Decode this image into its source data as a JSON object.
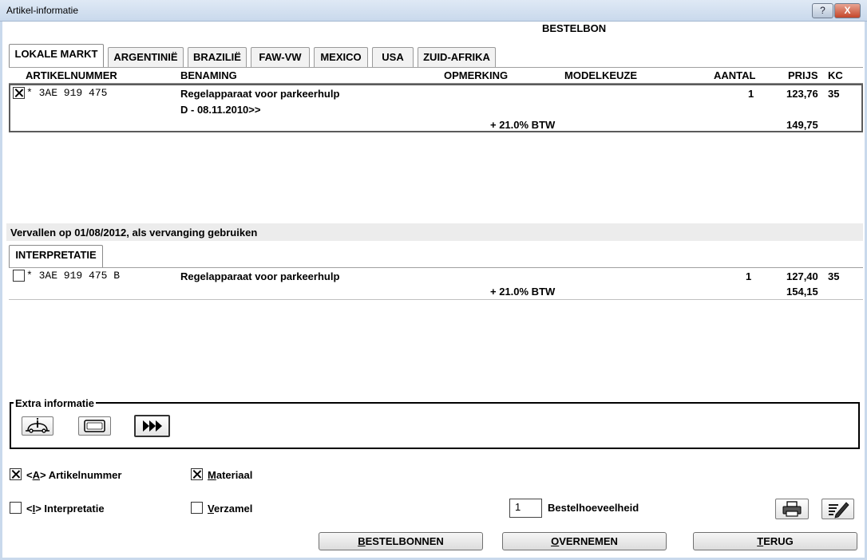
{
  "window": {
    "title": "Artikel-informatie",
    "help_label": "?",
    "close_label": "X"
  },
  "header": {
    "order_title": "BESTELBON"
  },
  "tabs": [
    {
      "label": "LOKALE MARKT",
      "active": true
    },
    {
      "label": "ARGENTINIË",
      "active": false
    },
    {
      "label": "BRAZILIË",
      "active": false
    },
    {
      "label": "FAW-VW",
      "active": false
    },
    {
      "label": "MEXICO",
      "active": false
    },
    {
      "label": "USA",
      "active": false
    },
    {
      "label": "ZUID-AFRIKA",
      "active": false
    }
  ],
  "columns": {
    "article_number": "ARTIKELNUMMER",
    "name": "BENAMING",
    "remark": "OPMERKING",
    "model_choice": "MODELKEUZE",
    "quantity": "AANTAL",
    "price": "PRIJS",
    "kc": "KC"
  },
  "main_item": {
    "checked": true,
    "article_number": "* 3AE 919 475",
    "name": "Regelapparaat voor parkeerhulp",
    "name_line2": "D - 08.11.2010>>",
    "quantity": "1",
    "price": "123,76",
    "kc": "35",
    "vat_label": "+ 21.0% BTW",
    "price_incl_vat": "149,75"
  },
  "replacement": {
    "notice": "Vervallen op 01/08/2012, als vervanging gebruiken",
    "tab_label": "INTERPRETATIE",
    "item": {
      "checked": false,
      "article_number": "* 3AE 919 475 B",
      "name": "Regelapparaat voor parkeerhulp",
      "quantity": "1",
      "price": "127,40",
      "kc": "35",
      "vat_label": "+ 21.0% BTW",
      "price_incl_vat": "154,15"
    }
  },
  "extra_info": {
    "legend": "Extra informatie"
  },
  "options": {
    "article_number": {
      "prefix": "<",
      "key": "A",
      "suffix": "> Artikelnummer",
      "checked": true
    },
    "interpretation": {
      "prefix": "<",
      "key": "I",
      "suffix": "> Interpretatie",
      "checked": false
    },
    "material": {
      "key": "M",
      "rest": "ateriaal",
      "checked": true
    },
    "collection": {
      "key": "V",
      "rest": "erzamel",
      "checked": false
    }
  },
  "order_quantity": {
    "value": "1",
    "label": "Bestelhoeveelheid"
  },
  "buttons": {
    "order_forms": {
      "key": "B",
      "rest": "ESTELBONNEN"
    },
    "adopt": {
      "key": "O",
      "rest": "VERNEMEN"
    },
    "back": {
      "key": "T",
      "rest": "ERUG"
    }
  }
}
